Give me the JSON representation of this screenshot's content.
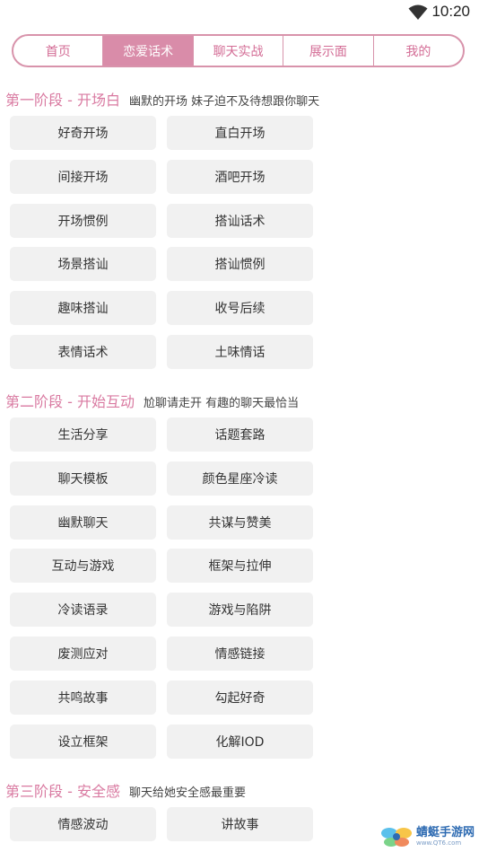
{
  "status": {
    "time": "10:20"
  },
  "tabs": [
    {
      "label": "首页"
    },
    {
      "label": "恋爱话术",
      "active": true
    },
    {
      "label": "聊天实战"
    },
    {
      "label": "展示面"
    },
    {
      "label": "我的"
    }
  ],
  "sections": [
    {
      "title": "第一阶段 - 开场白",
      "subtitle": "幽默的开场 妹子迫不及待想跟你聊天",
      "items": [
        "好奇开场",
        "直白开场",
        "间接开场",
        "酒吧开场",
        "开场惯例",
        "搭讪话术",
        "场景搭讪",
        "搭讪惯例",
        "趣味搭讪",
        "收号后续",
        "表情话术",
        "土味情话"
      ]
    },
    {
      "title": "第二阶段 - 开始互动",
      "subtitle": "尬聊请走开 有趣的聊天最恰当",
      "items": [
        "生活分享",
        "话题套路",
        "聊天模板",
        "颜色星座冷读",
        "幽默聊天",
        "共谋与赞美",
        "互动与游戏",
        "框架与拉伸",
        "冷读语录",
        "游戏与陷阱",
        "废测应对",
        "情感链接",
        "共鸣故事",
        "勾起好奇",
        "设立框架",
        "化解IOD"
      ]
    },
    {
      "title": "第三阶段 - 安全感",
      "subtitle": "聊天给她安全感最重要",
      "items": [
        "情感波动",
        "讲故事"
      ]
    }
  ],
  "watermark": {
    "name": "蜻蜓手游网",
    "url": "www.QT6.com"
  },
  "colors": {
    "accent": "#d98ca9",
    "section_title": "#d97aa1",
    "pill_bg": "#f1f1f1"
  }
}
